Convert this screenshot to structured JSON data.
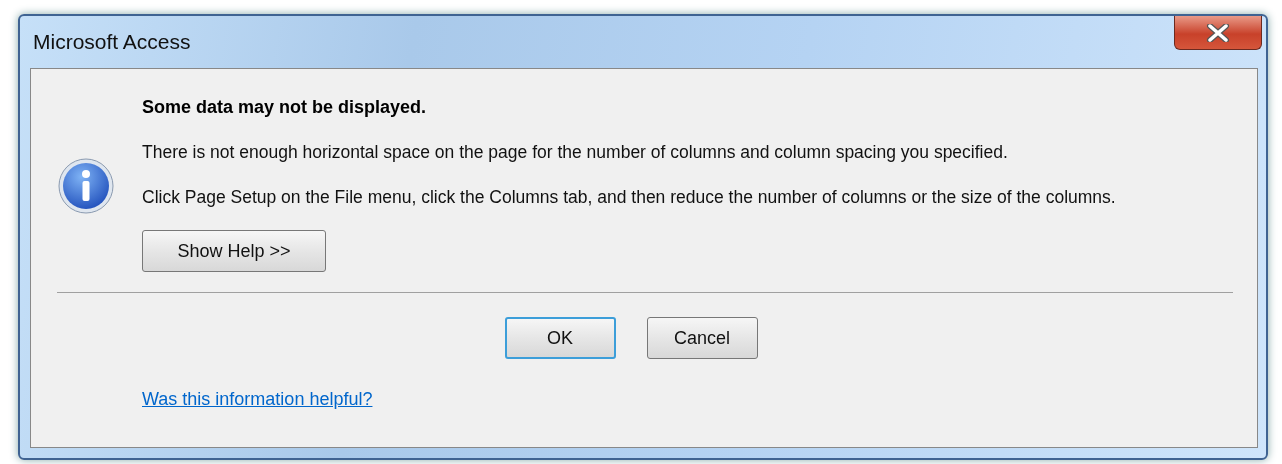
{
  "window": {
    "title": "Microsoft Access"
  },
  "message": {
    "heading": "Some data may not be displayed.",
    "paragraphs": [
      "There is not enough horizontal space on the page for the number of columns and column spacing you specified.",
      "Click Page Setup on the File menu, click the Columns tab, and then reduce the number of columns or the size of the columns."
    ]
  },
  "help_button": "Show Help >>",
  "buttons": [
    {
      "label": "OK",
      "default": true
    },
    {
      "label": "Cancel",
      "default": false
    }
  ],
  "feedback_link": "Was this information helpful?"
}
